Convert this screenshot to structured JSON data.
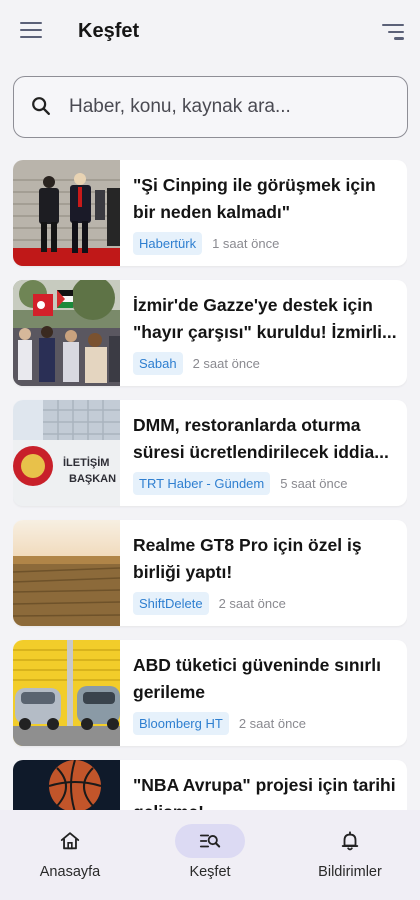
{
  "header": {
    "title": "Keşfet"
  },
  "search": {
    "placeholder": "Haber, konu, kaynak ara..."
  },
  "articles": [
    {
      "title": "\"Şi Cinping ile görüşmek için bir neden kalmadı\"",
      "source": "Habertürk",
      "time": "1 saat önce"
    },
    {
      "title": "İzmir'de Gazze'ye destek için \"hayır çarşısı\" kuruldu! İzmirli...",
      "source": "Sabah",
      "time": "2 saat önce"
    },
    {
      "title": "DMM, restoranlarda oturma süresi ücretlendirilecek iddia...",
      "source": "TRT Haber - Gündem",
      "time": "5 saat önce"
    },
    {
      "title": "Realme GT8 Pro için özel iş birliği yaptı!",
      "source": "ShiftDelete",
      "time": "2 saat önce"
    },
    {
      "title": "ABD tüketici güveninde sınırlı gerileme",
      "source": "Bloomberg HT",
      "time": "2 saat önce"
    },
    {
      "title": "\"NBA Avrupa\" projesi için tarihi gelişme!",
      "source": "",
      "time": ""
    }
  ],
  "nav": [
    {
      "label": "Anasayfa",
      "icon": "home-icon"
    },
    {
      "label": "Keşfet",
      "icon": "explore-icon",
      "active": true
    },
    {
      "label": "Bildirimler",
      "icon": "bell-icon"
    }
  ]
}
